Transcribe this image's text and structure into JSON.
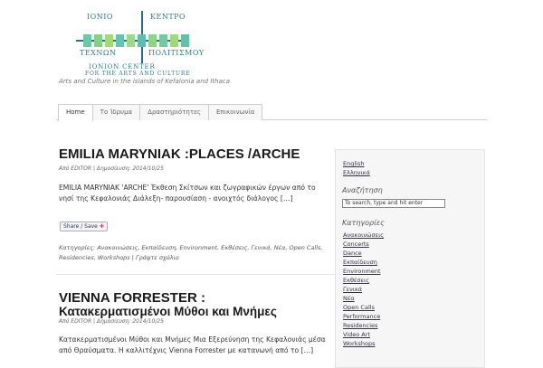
{
  "site": {
    "logo": {
      "line1_left": "ΙΟΝΙΟ",
      "line1_right": "ΚΕΝΤΡΟ",
      "line2_left": "ΤΕΧΝΩΝ",
      "line2_right": "ΠΟΛΙΤΙΣΜΟΥ",
      "english1": "IONION CENTER",
      "english2": "FOR THE ARTS AND CULTURE",
      "square_colors": [
        "#6ec7a6",
        "#86cf8b",
        "#a3d97a",
        "#68c2b1",
        "#9ad88a",
        "#5fbcae",
        "#8fd28a",
        "#76c8a0",
        "#a0d87e",
        "#66c0a8"
      ]
    },
    "tagline": "Arts and Culture in the islands of Kefalonia and Ithaca"
  },
  "nav": {
    "tabs": [
      "Home",
      "Το Ίδρυμα",
      "Δραστηριότητες",
      "Επικοινωνία"
    ]
  },
  "posts": [
    {
      "title": "EMILIA MARYNIAK :PLACES /ARCHE",
      "meta": "Από EDITOR | Δημοσίευση: 2014/10/25",
      "excerpt": "EMILIA MARYNIAK 'ARCHE'     Έκθεση Σκίτσων και ζωγραφικών έργων από το νησί της Κεφαλονιάς  Διάλεξη-  παρουσίαση - ανοιχτός διάλογος  […]",
      "share": "Share / Save",
      "categories": "Κατηγορίες: Ανακοινώσεις, Εκπαίδευση, Environment, Εκθέσεις, Γενικά, Νέα, Open Calls, Residencies, Workshops | Γράψτε σχόλιο"
    },
    {
      "title_line1": "VIENNA FORRESTER :",
      "title_line2": "Κατακερματισμένοι Μύθοι και Μνήμες",
      "meta": "Από EDITOR | Δημοσίευση: 2014/10/25",
      "excerpt": "  Κατακερματισμένοι  Μύθοι και  Μνήμες Μια Εξερεύνηση της Κεφαλονιάς μέσα από Θραύσματα. Η καλλιτέχνις  Vienna Forrester με κατανωνή από το  […]"
    }
  ],
  "sidebar": {
    "languages": [
      "English",
      "Ελληνικά"
    ],
    "search_heading": "Αναζήτηση",
    "search_value": "To search, type and hit enter",
    "categories_heading": "Κατηγορίες",
    "categories": [
      "Ανακοινώσεις",
      "Concerts",
      "Dance",
      "Εκπαίδευση",
      "Environment",
      "Εκθέσεις",
      "Γενικά",
      "Νέα",
      "Open Calls",
      "Performance",
      "Residencies",
      "Video Art",
      "Workshops"
    ]
  }
}
